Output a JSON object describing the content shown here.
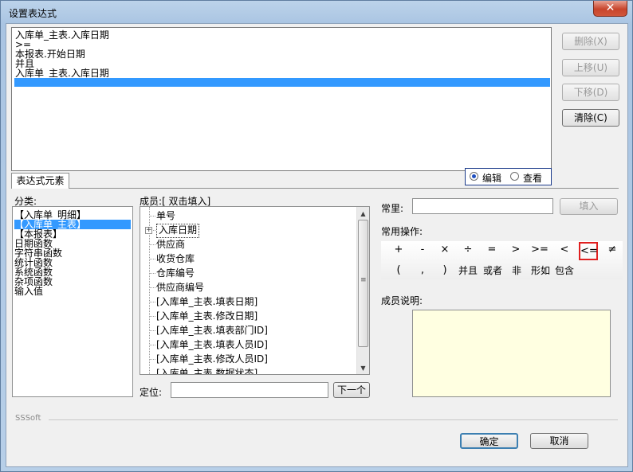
{
  "window": {
    "title": "设置表达式",
    "close_glyph": "✕"
  },
  "expression": {
    "lines": [
      "入库单_主表.入库日期",
      ">=",
      "本报表.开始日期",
      "并且",
      "入库单_主表.入库日期"
    ]
  },
  "side_buttons": {
    "delete": "删除(X)",
    "move_up": "上移(U)",
    "move_down": "下移(D)",
    "clear": "清除(C)"
  },
  "tab": {
    "label": "表达式元素"
  },
  "mode": {
    "edit": "编辑",
    "view": "查看",
    "selected": "edit"
  },
  "category": {
    "label": "分类:",
    "items": [
      "【入库单_明细】",
      "【入库单_主表】",
      "【本报表】",
      "日期函数",
      "字符串函数",
      "统计函数",
      "系统函数",
      "杂项函数",
      "输入值"
    ],
    "selected_index": 1
  },
  "members": {
    "label": "成员:[ 双击填入]",
    "items": [
      "单号",
      "入库日期",
      "供应商",
      "收货仓库",
      "仓库编号",
      "供应商编号",
      "[入库单_主表.填表日期]",
      "[入库单_主表.修改日期]",
      "[入库单_主表.填表部门ID]",
      "[入库单_主表.填表人员ID]",
      "[入库单_主表.修改人员ID]",
      "[入库单_主表.数据状态]"
    ],
    "focused_index": 1,
    "expander_glyph": "+"
  },
  "locate": {
    "label": "定位:",
    "value": "",
    "next_button": "下一个"
  },
  "constant": {
    "label": "常里:",
    "value": "",
    "fill_button": "填入"
  },
  "operators": {
    "label": "常用操作:",
    "row1": [
      "+",
      "-",
      "×",
      "÷",
      "=",
      ">",
      ">=",
      "<",
      "<=",
      "≠"
    ],
    "row2": [
      "(",
      ",",
      ")",
      "并且",
      "或者",
      "非",
      "形如",
      "包含"
    ],
    "highlighted": "<="
  },
  "member_desc": {
    "label": "成员说明:"
  },
  "footer": {
    "brand": "SSSoft",
    "ok": "确定",
    "cancel": "取消"
  },
  "scroll": {
    "up": "▲",
    "down": "▼",
    "grip": "≡"
  },
  "colors": {
    "selection": "#3399ff",
    "highlight_border": "#e02020",
    "desc_bg": "#ffffe1",
    "radio_group_border": "#1a3a8a"
  }
}
